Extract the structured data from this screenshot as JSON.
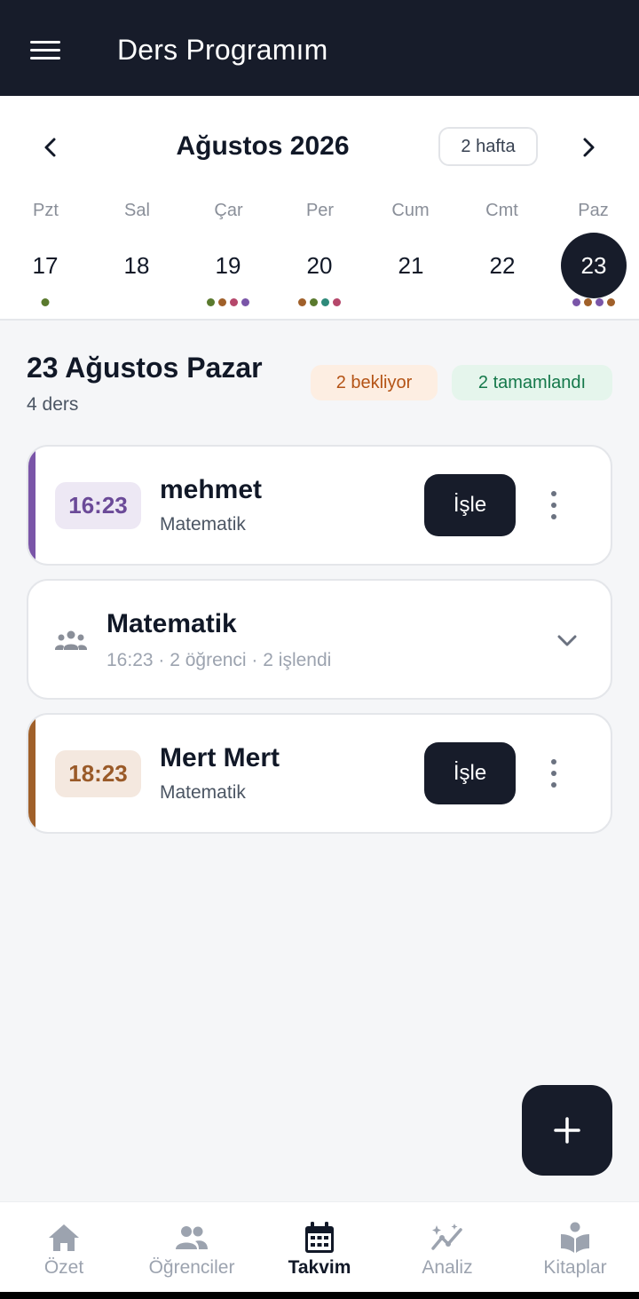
{
  "app": {
    "title": "Ders Programım"
  },
  "calendar": {
    "month_label": "Ağustos 2026",
    "range_label": "2 hafta",
    "weekdays": [
      "Pzt",
      "Sal",
      "Çar",
      "Per",
      "Cum",
      "Cmt",
      "Paz"
    ],
    "days": [
      "17",
      "18",
      "19",
      "20",
      "21",
      "22",
      "23"
    ],
    "selected_day": "23",
    "day_dots": [
      [
        "#5a7a2e"
      ],
      [],
      [
        "#5a7a2e",
        "#a0602a",
        "#b5476b",
        "#7a55a8"
      ],
      [
        "#a0602a",
        "#5a7a2e",
        "#2e8a7a",
        "#b5476b"
      ],
      [],
      [],
      [
        "#7a55a8",
        "#a0602a",
        "#7a55a8",
        "#a0602a"
      ]
    ]
  },
  "day": {
    "title": "23 Ağustos Pazar",
    "subtitle": "4 ders",
    "pending_label": "2 bekliyor",
    "done_label": "2 tamamlandı"
  },
  "lessons": [
    {
      "time": "16:23",
      "name": "mehmet",
      "subject": "Matematik",
      "action": "İşle",
      "accent": "#7a55a8",
      "chip_bg": "#ede8f4",
      "chip_fg": "#6b4a98"
    },
    {
      "time": "18:23",
      "name": "Mert Mert",
      "subject": "Matematik",
      "action": "İşle",
      "accent": "#a0602a",
      "chip_bg": "#f4e8df",
      "chip_fg": "#9a5a28"
    }
  ],
  "group": {
    "title": "Matematik",
    "meta": "16:23 · 2 öğrenci · 2 işlendi"
  },
  "bottom_nav": [
    {
      "label": "Özet",
      "icon": "home-icon"
    },
    {
      "label": "Öğrenciler",
      "icon": "people-icon"
    },
    {
      "label": "Takvim",
      "icon": "calendar-icon",
      "active": true
    },
    {
      "label": "Analiz",
      "icon": "analytics-icon"
    },
    {
      "label": "Kitaplar",
      "icon": "book-reader-icon"
    }
  ]
}
